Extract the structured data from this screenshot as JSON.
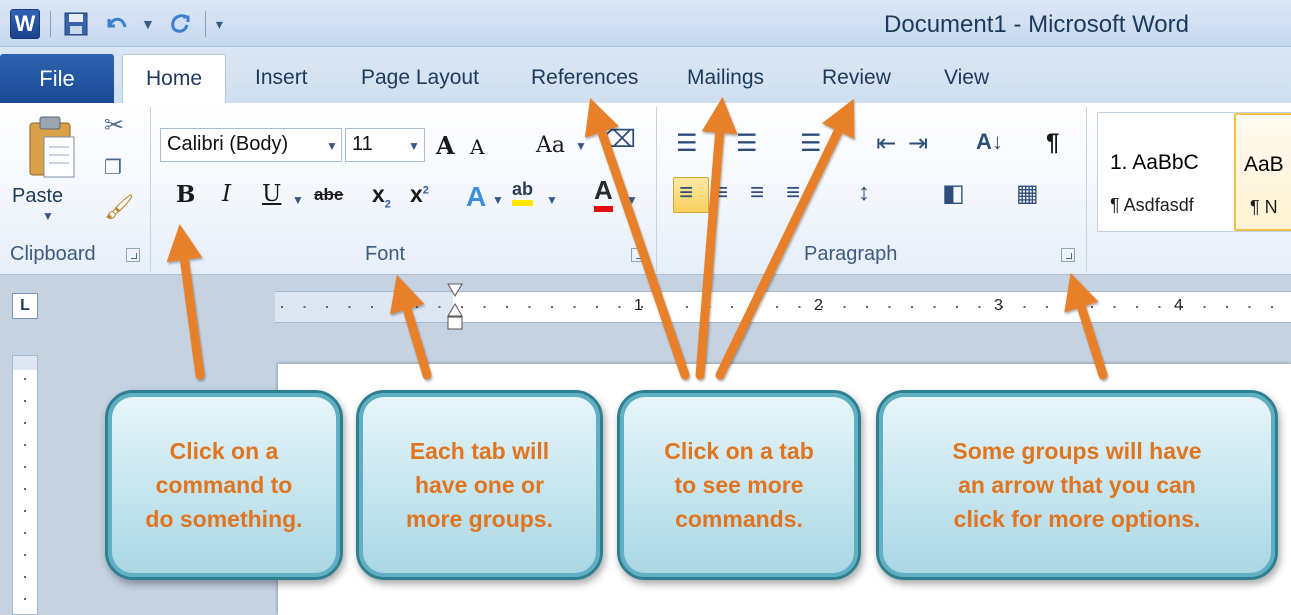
{
  "window": {
    "title": "Document1 - Microsoft Word",
    "app_icon": "W"
  },
  "quick_access": {
    "icons": [
      "word-logo-icon",
      "save-icon",
      "undo-icon",
      "redo-icon",
      "customize-qat-icon"
    ]
  },
  "tabs": {
    "file": "File",
    "items": [
      "Home",
      "Insert",
      "Page Layout",
      "References",
      "Mailings",
      "Review",
      "View"
    ],
    "active": "Home"
  },
  "clipboard": {
    "paste_label": "Paste",
    "group_label": "Clipboard"
  },
  "font": {
    "font_name": "Calibri (Body)",
    "font_size": "11",
    "grow_label": "A",
    "shrink_label": "A",
    "case_label": "Aa",
    "bold": "B",
    "italic": "I",
    "underline": "U",
    "strikethrough": "abe",
    "subscript": "x",
    "superscript": "x",
    "text_effects": "A",
    "highlight": "ab",
    "font_color": "A",
    "group_label": "Font",
    "font_color_hex": "#e01010",
    "highlight_hex": "#ffe600"
  },
  "paragraph": {
    "group_label": "Paragraph",
    "show_marks": "¶",
    "sort": "A↓"
  },
  "styles": {
    "items": [
      {
        "sample": "1. AaBbC",
        "name": "¶ Asdfasdf"
      },
      {
        "sample": "AaB",
        "name": "¶ N"
      }
    ]
  },
  "ruler": {
    "tab_selector": "L",
    "numbers": [
      "1",
      "2",
      "3",
      "4"
    ]
  },
  "callouts": [
    {
      "text": "Click on a\ncommand to\ndo something."
    },
    {
      "text": "Each tab will\nhave one or\nmore groups."
    },
    {
      "text": "Click on a tab\nto see more\ncommands."
    },
    {
      "text": "Some groups will have\nan arrow that you can\nclick for more options."
    }
  ],
  "colors": {
    "file_tab": "#2b5ca8",
    "callout_text": "#e0741f",
    "callout_border": "#2e7f8f",
    "arrow": "#e8802a"
  }
}
